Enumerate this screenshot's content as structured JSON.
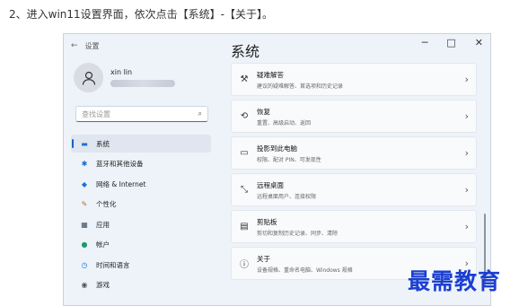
{
  "instruction": "2、进入win11设置界面，依次点击【系统】-【关于】。",
  "window": {
    "back_icon": "←",
    "app_title": "设置",
    "page_title": "系统",
    "controls": [
      "─",
      "□",
      "✕"
    ]
  },
  "user": {
    "name": "xin lin"
  },
  "search": {
    "placeholder": "查找设置",
    "icon": "⌕"
  },
  "sidebar": {
    "items": [
      {
        "icon": "▬",
        "label": "系统"
      },
      {
        "icon": "✱",
        "label": "蓝牙和其他设备"
      },
      {
        "icon": "◆",
        "label": "网络 & Internet"
      },
      {
        "icon": "✎",
        "label": "个性化"
      },
      {
        "icon": "▦",
        "label": "应用"
      },
      {
        "icon": "●",
        "label": "帐户"
      },
      {
        "icon": "◷",
        "label": "时间和语言"
      },
      {
        "icon": "◉",
        "label": "游戏"
      }
    ]
  },
  "cards": [
    {
      "icon": "⚒",
      "title": "疑难解答",
      "desc": "建议的疑难解答、首选项和历史记录"
    },
    {
      "icon": "⟲",
      "title": "恢复",
      "desc": "重置、高级启动、返回"
    },
    {
      "icon": "▭",
      "title": "投影到此电脑",
      "desc": "权限、配对 PIN、可发现性"
    },
    {
      "icon": "⤡",
      "title": "远程桌面",
      "desc": "远程桌面用户、连接权限"
    },
    {
      "icon": "▤",
      "title": "剪贴板",
      "desc": "剪切和复制历史记录、同步、清除"
    },
    {
      "icon": "ⓘ",
      "title": "关于",
      "desc": "设备规格、重命名电脑、Windows 规格"
    }
  ],
  "chevron": "›",
  "watermark": "最需教育",
  "colors": {
    "accent": "#0067c0",
    "watermark": "#1b3fd1"
  }
}
